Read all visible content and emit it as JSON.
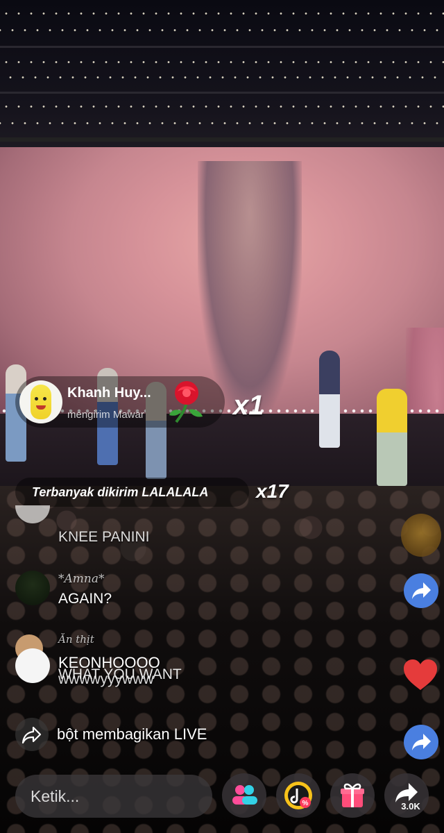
{
  "gift": {
    "sender": "Khanh Huy...",
    "action": "mengirim Mawar",
    "count": "x1",
    "gift_icon": "rose-icon"
  },
  "top_gift": {
    "text": "Terbanyak dikirim LALALALA",
    "count": "x17"
  },
  "comments": [
    {
      "text": "KNEE PANINI"
    },
    {
      "name": "*Amna*",
      "text": "AGAIN?"
    },
    {
      "name": "Ăn thịt",
      "text": "KEONHOOOO"
    },
    {
      "name": "WHAT YOU WANT",
      "text": "wwwwyyywww"
    }
  ],
  "share_notice": "bột membagikan LIVE",
  "input": {
    "placeholder": "Ketik..."
  },
  "share": {
    "count": "3.0K"
  },
  "colors": {
    "accent_blue": "#4a7fe0",
    "heart_red": "#e53b3b",
    "gift_pink": "#ff4d7a"
  }
}
